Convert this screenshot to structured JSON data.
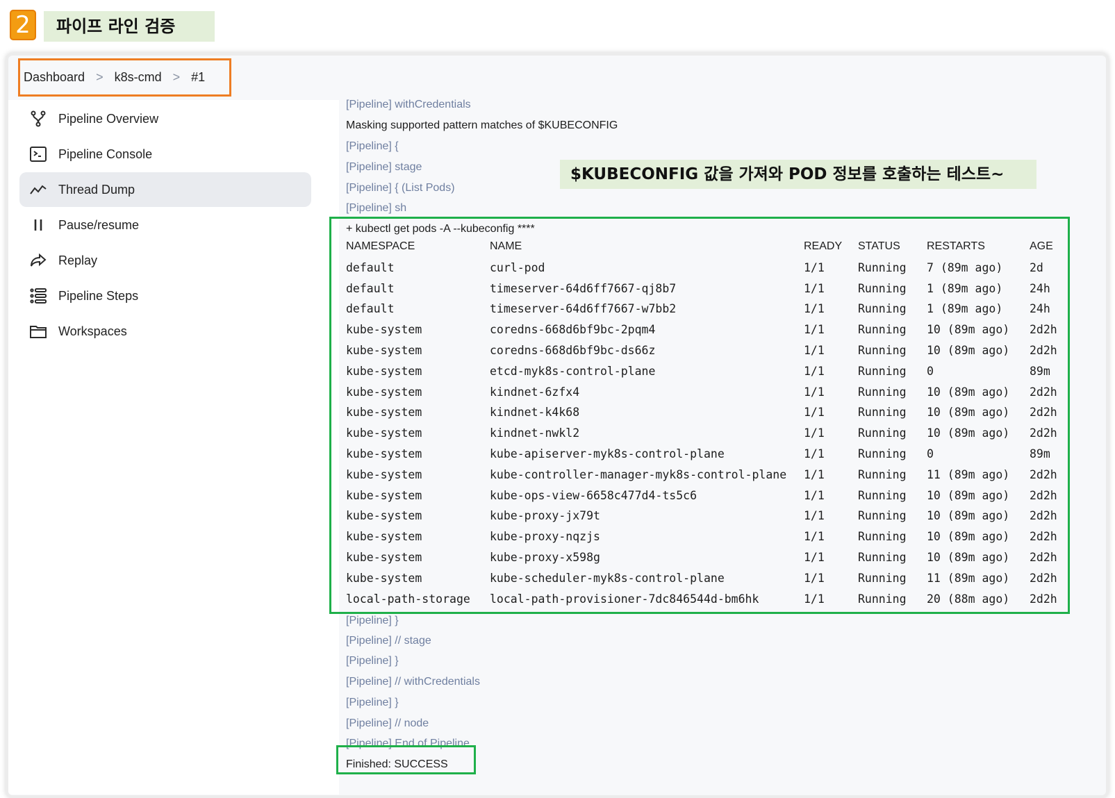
{
  "step": {
    "number": "2",
    "title": "파이프 라인 검증"
  },
  "breadcrumb": {
    "items": [
      "Dashboard",
      "k8s-cmd",
      "#1"
    ],
    "separator": ">"
  },
  "sidebar": {
    "items": [
      {
        "label": "Pipeline Overview",
        "icon": "pipeline-overview-icon"
      },
      {
        "label": "Pipeline Console",
        "icon": "terminal-icon"
      },
      {
        "label": "Thread Dump",
        "icon": "thread-dump-icon",
        "active": true
      },
      {
        "label": "Pause/resume",
        "icon": "pause-icon"
      },
      {
        "label": "Replay",
        "icon": "replay-icon"
      },
      {
        "label": "Pipeline Steps",
        "icon": "pipeline-steps-icon"
      },
      {
        "label": "Workspaces",
        "icon": "folder-icon"
      }
    ]
  },
  "annotation": "$KUBECONFIG 값을 가져와 POD 정보를 호출하는 테스트~",
  "console": {
    "pre_lines": [
      "[Pipeline] withCredentials",
      "Masking supported pattern matches of $KUBECONFIG",
      "[Pipeline] {",
      "[Pipeline] stage",
      "[Pipeline] { (List Pods)",
      "[Pipeline] sh",
      "+ kubectl get pods -A --kubeconfig ****"
    ],
    "table": {
      "headers": [
        "NAMESPACE",
        "NAME",
        "READY",
        "STATUS",
        "RESTARTS",
        "AGE"
      ],
      "rows": [
        [
          "default",
          "curl-pod",
          "1/1",
          "Running",
          "7 (89m ago)",
          "2d"
        ],
        [
          "default",
          "timeserver-64d6ff7667-qj8b7",
          "1/1",
          "Running",
          "1 (89m ago)",
          "24h"
        ],
        [
          "default",
          "timeserver-64d6ff7667-w7bb2",
          "1/1",
          "Running",
          "1 (89m ago)",
          "24h"
        ],
        [
          "kube-system",
          "coredns-668d6bf9bc-2pqm4",
          "1/1",
          "Running",
          "10 (89m ago)",
          "2d2h"
        ],
        [
          "kube-system",
          "coredns-668d6bf9bc-ds66z",
          "1/1",
          "Running",
          "10 (89m ago)",
          "2d2h"
        ],
        [
          "kube-system",
          "etcd-myk8s-control-plane",
          "1/1",
          "Running",
          "0",
          "89m"
        ],
        [
          "kube-system",
          "kindnet-6zfx4",
          "1/1",
          "Running",
          "10 (89m ago)",
          "2d2h"
        ],
        [
          "kube-system",
          "kindnet-k4k68",
          "1/1",
          "Running",
          "10 (89m ago)",
          "2d2h"
        ],
        [
          "kube-system",
          "kindnet-nwkl2",
          "1/1",
          "Running",
          "10 (89m ago)",
          "2d2h"
        ],
        [
          "kube-system",
          "kube-apiserver-myk8s-control-plane",
          "1/1",
          "Running",
          "0",
          "89m"
        ],
        [
          "kube-system",
          "kube-controller-manager-myk8s-control-plane",
          "1/1",
          "Running",
          "11 (89m ago)",
          "2d2h"
        ],
        [
          "kube-system",
          "kube-ops-view-6658c477d4-ts5c6",
          "1/1",
          "Running",
          "10 (89m ago)",
          "2d2h"
        ],
        [
          "kube-system",
          "kube-proxy-jx79t",
          "1/1",
          "Running",
          "10 (89m ago)",
          "2d2h"
        ],
        [
          "kube-system",
          "kube-proxy-nqzjs",
          "1/1",
          "Running",
          "10 (89m ago)",
          "2d2h"
        ],
        [
          "kube-system",
          "kube-proxy-x598g",
          "1/1",
          "Running",
          "10 (89m ago)",
          "2d2h"
        ],
        [
          "kube-system",
          "kube-scheduler-myk8s-control-plane",
          "1/1",
          "Running",
          "11 (89m ago)",
          "2d2h"
        ],
        [
          "local-path-storage",
          "local-path-provisioner-7dc846544d-bm6hk",
          "1/1",
          "Running",
          "20 (88m ago)",
          "2d2h"
        ]
      ]
    },
    "post_lines": [
      "[Pipeline] }",
      "[Pipeline] // stage",
      "[Pipeline] }",
      "[Pipeline] // withCredentials",
      "[Pipeline] }",
      "[Pipeline] // node",
      "[Pipeline] End of Pipeline",
      "Finished: SUCCESS"
    ]
  },
  "colors": {
    "highlight_orange": "#ee7d23",
    "highlight_green": "#1fb04a",
    "pipeline_text": "#6f7fa0",
    "annotation_bg": "#e3efd9"
  }
}
